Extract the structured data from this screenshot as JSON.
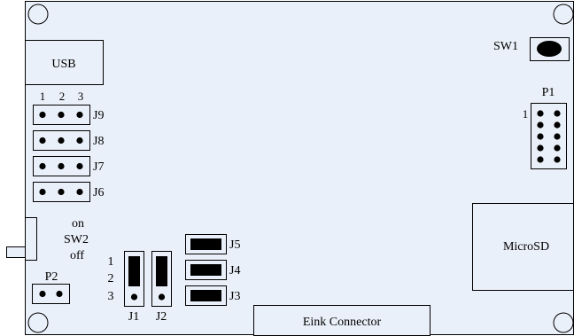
{
  "colors": {
    "board": "#eaf0f9",
    "stroke": "#000000",
    "dot": "#000000"
  },
  "usb": {
    "label": "USB"
  },
  "sw1": {
    "label": "SW1"
  },
  "p1": {
    "label": "P1",
    "pin_label": "1"
  },
  "pin_numbers": [
    "1",
    "2",
    "3"
  ],
  "headers_3pin": [
    {
      "label": "J9"
    },
    {
      "label": "J8"
    },
    {
      "label": "J7"
    },
    {
      "label": "J6"
    }
  ],
  "sw2": {
    "on_label": "on",
    "name": "SW2",
    "off_label": "off"
  },
  "p2": {
    "label": "P2"
  },
  "vertical_jumpers": {
    "pin_labels": [
      "1",
      "2",
      "3"
    ],
    "items": [
      {
        "label": "J1"
      },
      {
        "label": "J2"
      }
    ]
  },
  "horizontal_jumpers": [
    {
      "label": "J5"
    },
    {
      "label": "J4"
    },
    {
      "label": "J3"
    }
  ],
  "microsd": {
    "label": "MicroSD"
  },
  "eink": {
    "label": "Eink Connector"
  }
}
